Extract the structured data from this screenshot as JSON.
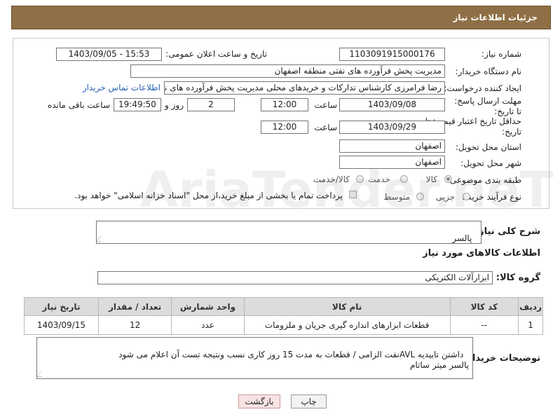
{
  "header": {
    "title": "جزئیات اطلاعات نیاز"
  },
  "fields": {
    "need_number_label": "شماره نیاز:",
    "need_number": "1103091915000176",
    "announce_label": "تاریخ و ساعت اعلان عمومی:",
    "announce_value": "1403/09/05 - 15:53",
    "buyer_org_label": "نام دستگاه خریدار:",
    "buyer_org": "مدیریت پخش فرآورده های نفتی منطقه اصفهان",
    "creator_label": "ایجاد کننده درخواست:",
    "creator": "رضا فرامرزی کارشناس تدارکات و خریدهای محلی مدیریت پخش فرآورده های نفتی",
    "contact_link": "اطلاعات تماس خریدار",
    "deadline_label": "مهلت ارسال پاسخ: تا تاریخ:",
    "deadline_date": "1403/09/08",
    "time_label": "ساعت",
    "deadline_time": "12:00",
    "days_value": "2",
    "days_label": "روز و",
    "remaining_time": "19:49:50",
    "remaining_label": "ساعت باقی مانده",
    "validity_label": "حداقل تاریخ اعتبار قیمت: تا تاریخ:",
    "validity_date": "1403/09/29",
    "validity_time": "12:00",
    "province_label": "استان محل تحویل:",
    "province": "اصفهان",
    "city_label": "شهر محل تحویل:",
    "city": "اصفهان",
    "category_label": "طبقه بندی موضوعی:",
    "category_options": [
      "کالا",
      "خدمت",
      "کالا/خدمت"
    ],
    "process_label": "نوع فرآیند خرید :",
    "process_options": [
      "جزیی",
      "متوسط"
    ],
    "payment_note": "پرداخت تمام یا بخشی از مبلغ خرید،از محل \"اسناد خزانه اسلامی\" خواهد بود."
  },
  "summary": {
    "label": "شرح کلی نیاز:",
    "value": "پالسر"
  },
  "goods_section": {
    "title": "اطلاعات کالاهای مورد نیاز",
    "group_label": "گروه کالا:",
    "group_value": "ابزارآلات الکتریکی",
    "columns": [
      "ردیف",
      "کد کالا",
      "نام کالا",
      "واحد شمارش",
      "تعداد / مقدار",
      "تاریخ نیاز"
    ],
    "rows": [
      [
        "1",
        "--",
        "قطعات ابزارهای اندازه گیری جریان و ملزومات",
        "عدد",
        "12",
        "1403/09/15"
      ]
    ]
  },
  "buyer_notes": {
    "label": "توضیحات خریدار:",
    "value": "داشتن تاییدیه AVLنفت الزامی / قطعات به مدت 15 روز کاری نسب ونتیجه تست آن اعلام می شود\nپالسر میتر ساتام"
  },
  "buttons": {
    "print": "چاپ",
    "back": "بازگشت"
  },
  "watermark": "AriaTender.neT",
  "colors": {
    "header_bg": "#8f6f45",
    "link": "#2a62b8",
    "table_header": "#dcdcdc",
    "back_button": "#f7e3e3"
  }
}
